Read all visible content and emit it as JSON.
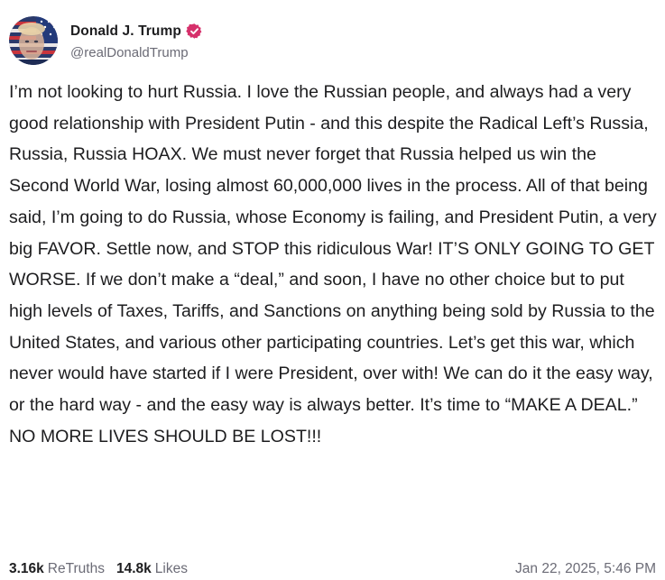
{
  "author": {
    "display_name": "Donald J. Trump",
    "handle": "@realDonaldTrump",
    "verified_icon": "verified-badge-icon",
    "badge_color": "#d6306b"
  },
  "post": {
    "text": "I’m not looking to hurt Russia. I love the Russian people, and always had a very good relationship with President Putin - and this despite the Radical Left’s Russia, Russia, Russia HOAX. We must never forget that Russia helped us win the Second World War, losing almost 60,000,000 lives in the process. All of that being said, I’m going to do Russia, whose Economy is failing, and President Putin, a very big FAVOR. Settle now, and STOP this ridiculous War! IT’S ONLY GOING TO GET WORSE. If we don’t make a “deal,” and soon, I have no other choice but to put high levels of Taxes, Tariffs, and Sanctions on anything being sold by Russia to the United States, and various other participating countries. Let’s get this war, which never would have started if I were President, over with! We can do it the easy way, or the hard way - and the easy way is always better. It’s time to “MAKE A DEAL.” NO MORE LIVES SHOULD BE LOST!!!"
  },
  "stats": {
    "retruths_count": "3.16k",
    "retruths_label": "ReTruths",
    "likes_count": "14.8k",
    "likes_label": "Likes"
  },
  "timestamp": "Jan 22, 2025, 5:46 PM"
}
